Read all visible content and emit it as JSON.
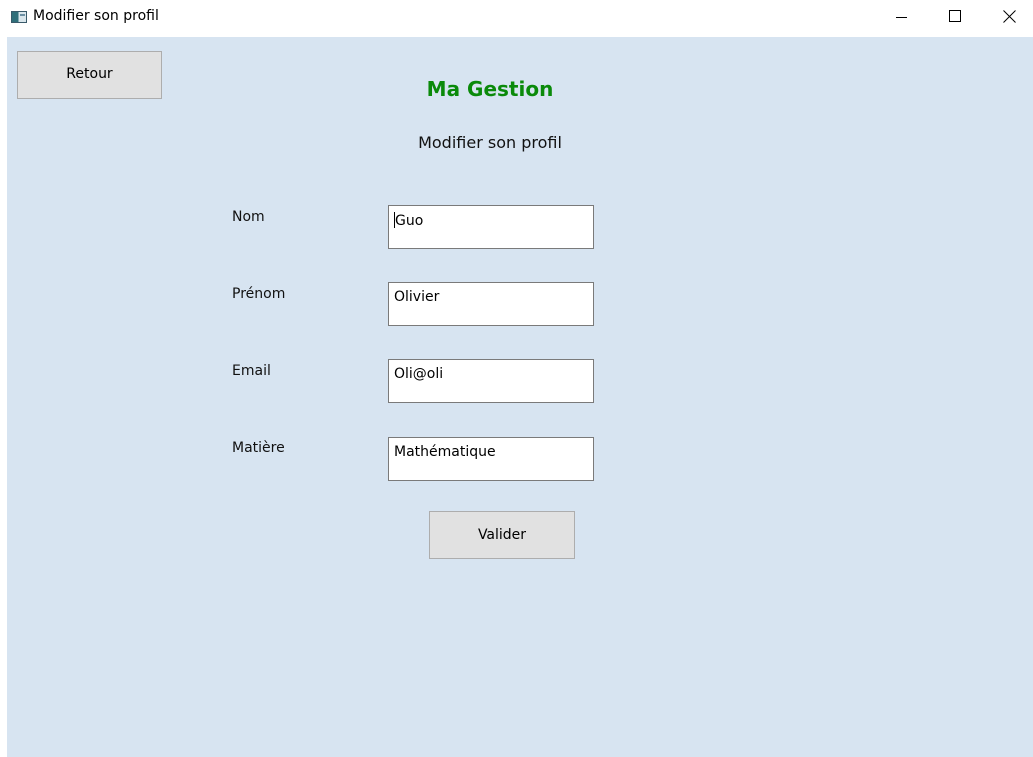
{
  "window": {
    "title": "Modifier son profil",
    "icon": "app-icon",
    "controls": {
      "minimize_icon": "minimize-icon",
      "maximize_icon": "maximize-icon",
      "close_icon": "close-icon"
    }
  },
  "toolbar": {
    "back_label": "Retour"
  },
  "header": {
    "app_name": "Ma Gestion",
    "page_title": "Modifier son profil",
    "app_name_color": "#0a8a0a"
  },
  "form": {
    "fields": [
      {
        "label": "Nom",
        "value": "Guo"
      },
      {
        "label": "Prénom",
        "value": "Olivier"
      },
      {
        "label": "Email",
        "value": "Oli@oli"
      },
      {
        "label": "Matière",
        "value": "Mathématique"
      }
    ],
    "submit_label": "Valider"
  },
  "colors": {
    "client_background": "#d7e4f1",
    "button_background": "#e1e1e1"
  }
}
